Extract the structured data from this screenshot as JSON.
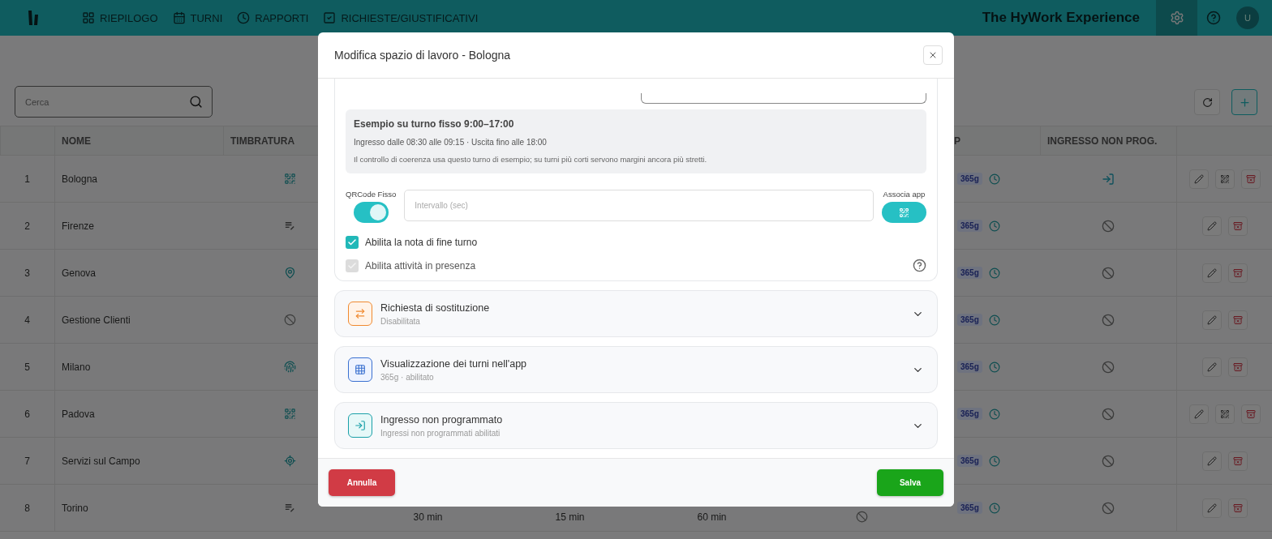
{
  "topbar": {
    "nav": [
      {
        "label": "RIEPILOGO"
      },
      {
        "label": "TURNI"
      },
      {
        "label": "RAPPORTI"
      },
      {
        "label": "RICHIESTE/GIUSTIFICATIVI"
      }
    ],
    "brand": "The HyWork Experience",
    "avatar": "U"
  },
  "search": {
    "placeholder": "Cerca"
  },
  "table": {
    "columns": [
      {},
      {
        "label": "NOME"
      },
      {
        "label": "TIMBRATURA"
      },
      {},
      {},
      {},
      {},
      {
        "label": "P"
      },
      {
        "label": "INGRESSO NON PROG."
      },
      {}
    ],
    "rows": [
      {
        "index": "1",
        "name": "Bologna",
        "stamp": {
          "kind": "qr"
        },
        "app": "365g",
        "entry": {
          "kind": "enter"
        },
        "actions": [
          {
            "kind": "edit"
          },
          {
            "kind": "qr"
          },
          {
            "kind": "delete"
          }
        ]
      },
      {
        "index": "2",
        "name": "Firenze",
        "stamp": {
          "kind": "note"
        },
        "app": "365g",
        "entry": {
          "kind": "none"
        },
        "actions": [
          {
            "kind": "edit"
          },
          {
            "kind": "delete"
          }
        ]
      },
      {
        "index": "3",
        "name": "Genova",
        "stamp": {
          "kind": "pin"
        },
        "app": "365g",
        "entry": {
          "kind": "none"
        },
        "actions": [
          {
            "kind": "edit"
          },
          {
            "kind": "delete"
          }
        ]
      },
      {
        "index": "4",
        "name": "Gestione Clienti",
        "stamp": {
          "kind": "none"
        },
        "app": "365g",
        "entry": {
          "kind": "none"
        },
        "actions": [
          {
            "kind": "edit"
          },
          {
            "kind": "delete"
          }
        ]
      },
      {
        "index": "5",
        "name": "Milano",
        "stamp": {
          "kind": "fingerprint"
        },
        "app": "365g",
        "entry": {
          "kind": "none"
        },
        "actions": [
          {
            "kind": "edit"
          },
          {
            "kind": "delete"
          }
        ]
      },
      {
        "index": "6",
        "name": "Padova",
        "stamp": {
          "kind": "qr"
        },
        "app": "365g",
        "entry": {
          "kind": "none"
        },
        "actions": [
          {
            "kind": "edit"
          },
          {
            "kind": "qr"
          },
          {
            "kind": "delete"
          }
        ]
      },
      {
        "index": "7",
        "name": "Servizi sul Campo",
        "stamp": {
          "kind": "gps"
        },
        "app": "365g",
        "entry": {
          "kind": "none"
        },
        "actions": [
          {
            "kind": "edit"
          },
          {
            "kind": "delete"
          }
        ]
      },
      {
        "index": "8",
        "name": "Torino",
        "stamp": {
          "kind": "note"
        },
        "column_4": "30 min",
        "column_5": "15 min",
        "column_6": "60 min",
        "app": "365g",
        "entry": {
          "kind": "none"
        },
        "actions": [
          {
            "kind": "edit"
          },
          {
            "kind": "delete"
          }
        ]
      }
    ]
  },
  "modal": {
    "title": "Modifica spazio di lavoro - Bologna",
    "example": {
      "title": "Esempio su turno fisso 9:00–17:00",
      "line": "Ingresso dalle 08:30 alle 09:15 · Uscita fino alle 18:00",
      "note": "Il controllo di coerenza usa questo turno di esempio; su turni più corti servono margini ancora più stretti."
    },
    "qr_toggle": {
      "label": "QRCode Fisso",
      "on": true
    },
    "interval": {
      "placeholder": "Intervallo (sec)"
    },
    "associate": {
      "label": "Associa app"
    },
    "checkboxes": [
      {
        "label": "Abilita la nota di fine turno",
        "checked": true,
        "disabled": false
      },
      {
        "label": "Abilita attività in presenza",
        "checked": true,
        "disabled": true
      }
    ],
    "sections": [
      {
        "kind": "swap",
        "title": "Richiesta di sostituzione",
        "subtitle": "Disabilitata"
      },
      {
        "kind": "grid",
        "title": "Visualizzazione dei turni nell'app",
        "subtitle": "365g · abilitato"
      },
      {
        "kind": "enter",
        "title": "Ingresso non programmato",
        "subtitle": "Ingressi non programmati abilitati"
      }
    ],
    "buttons": {
      "cancel": "Annulla",
      "save": "Salva"
    }
  }
}
